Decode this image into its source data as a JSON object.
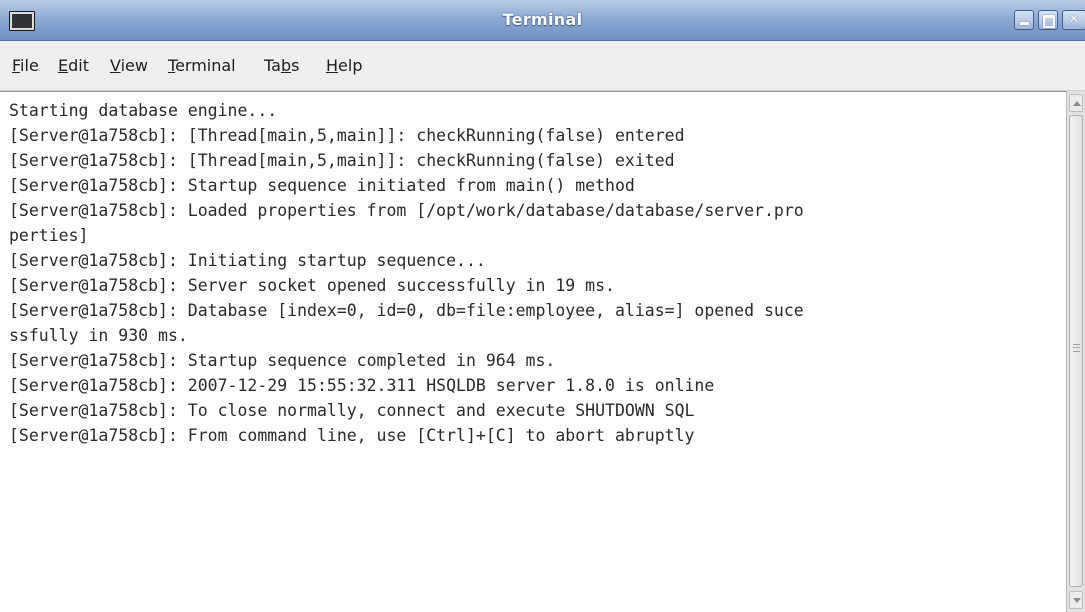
{
  "window": {
    "title": "Terminal"
  },
  "menu": [
    {
      "label": "File",
      "accel": "F",
      "rest": "ile"
    },
    {
      "label": "Edit",
      "accel": "E",
      "rest": "dit"
    },
    {
      "label": "View",
      "accel": "V",
      "rest": "iew"
    },
    {
      "label": "Terminal",
      "accel": "T",
      "rest": "erminal"
    },
    {
      "label": "Tabs",
      "pre": "Ta",
      "accel": "b",
      "rest": "s"
    },
    {
      "label": "Help",
      "accel": "H",
      "rest": "elp"
    }
  ],
  "terminal": {
    "lines": [
      "Starting database engine...",
      "[Server@1a758cb]: [Thread[main,5,main]]: checkRunning(false) entered",
      "[Server@1a758cb]: [Thread[main,5,main]]: checkRunning(false) exited",
      "[Server@1a758cb]: Startup sequence initiated from main() method",
      "[Server@1a758cb]: Loaded properties from [/opt/work/database/database/server.pro",
      "perties]",
      "[Server@1a758cb]: Initiating startup sequence...",
      "[Server@1a758cb]: Server socket opened successfully in 19 ms.",
      "[Server@1a758cb]: Database [index=0, id=0, db=file:employee, alias=] opened suce",
      "ssfully in 930 ms.",
      "[Server@1a758cb]: Startup sequence completed in 964 ms.",
      "[Server@1a758cb]: 2007-12-29 15:55:32.311 HSQLDB server 1.8.0 is online",
      "[Server@1a758cb]: To close normally, connect and execute SHUTDOWN SQL",
      "[Server@1a758cb]: From command line, use [Ctrl]+[C] to abort abruptly"
    ]
  },
  "icons": {
    "app": "terminal-icon",
    "minimize": "minimize-icon",
    "maximize": "maximize-icon",
    "close": "close-icon",
    "scroll_up": "arrow-up-icon",
    "scroll_down": "arrow-down-icon"
  },
  "colors": {
    "titlebar": "#8fabd4",
    "terminal_bg": "#ffffff",
    "terminal_fg": "#2a2a2a"
  }
}
